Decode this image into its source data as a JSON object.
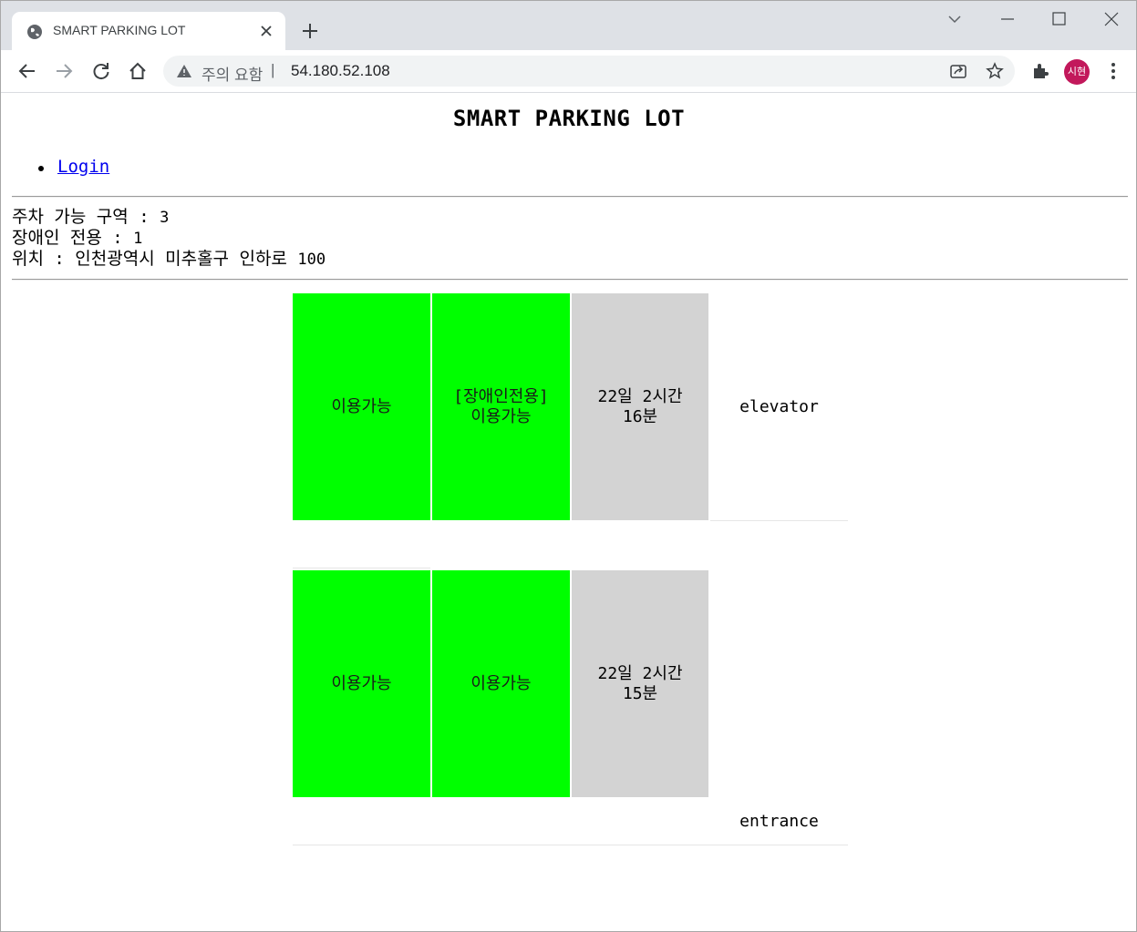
{
  "browser": {
    "tab_title": "SMART PARKING LOT",
    "security_label": "주의 요함",
    "url": "54.180.52.108",
    "profile_initials": "시현"
  },
  "page": {
    "title": "SMART PARKING LOT",
    "nav": [
      {
        "label": "Login"
      }
    ],
    "info": {
      "available_label": "주차 가능 구역 :",
      "available_value": "3",
      "disabled_label": "장애인 전용 :",
      "disabled_value": "1",
      "location_label": "위치 : 인천광역시 미추홀구 인하로",
      "location_value": "100"
    },
    "lot": {
      "row1": [
        {
          "status": "available",
          "line1": "이용가능",
          "line2": ""
        },
        {
          "status": "available",
          "line1": "[장애인전용]",
          "line2": "이용가능"
        },
        {
          "status": "occupied",
          "line1": "22일 2시간",
          "line2": "16분"
        }
      ],
      "row1_label": "elevator",
      "row2": [
        {
          "status": "available",
          "line1": "이용가능",
          "line2": ""
        },
        {
          "status": "available",
          "line1": "이용가능",
          "line2": ""
        },
        {
          "status": "occupied",
          "line1": "22일 2시간",
          "line2": "15분"
        }
      ],
      "row2_label": "entrance"
    }
  },
  "colors": {
    "available": "#00ff00",
    "occupied": "#d3d3d3",
    "link": "#0000ee"
  }
}
